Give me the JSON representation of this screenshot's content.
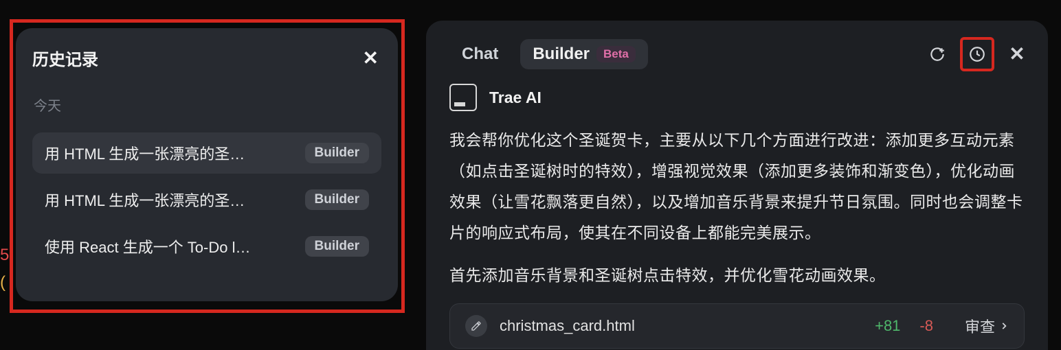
{
  "history": {
    "title": "历史记录",
    "group_label": "今天",
    "items": [
      {
        "title": "用 HTML 生成一张漂亮的圣…",
        "badge": "Builder"
      },
      {
        "title": "用 HTML 生成一张漂亮的圣…",
        "badge": "Builder"
      },
      {
        "title": "使用 React 生成一个 To-Do l…",
        "badge": "Builder"
      }
    ]
  },
  "bleed": {
    "line1": "5",
    "line2": "("
  },
  "chat": {
    "tabs": {
      "chat": "Chat",
      "builder": "Builder",
      "beta": "Beta"
    },
    "ai_name": "Trae AI",
    "paragraph1": "我会帮你优化这个圣诞贺卡，主要从以下几个方面进行改进：添加更多互动元素（如点击圣诞树时的特效），增强视觉效果（添加更多装饰和渐变色），优化动画效果（让雪花飘落更自然），以及增加音乐背景来提升节日氛围。同时也会调整卡片的响应式布局，使其在不同设备上都能完美展示。",
    "paragraph2": "首先添加音乐背景和圣诞树点击特效，并优化雪花动画效果。",
    "file": {
      "name": "christmas_card.html",
      "additions": "+81",
      "deletions": "-8",
      "review": "审查"
    }
  }
}
